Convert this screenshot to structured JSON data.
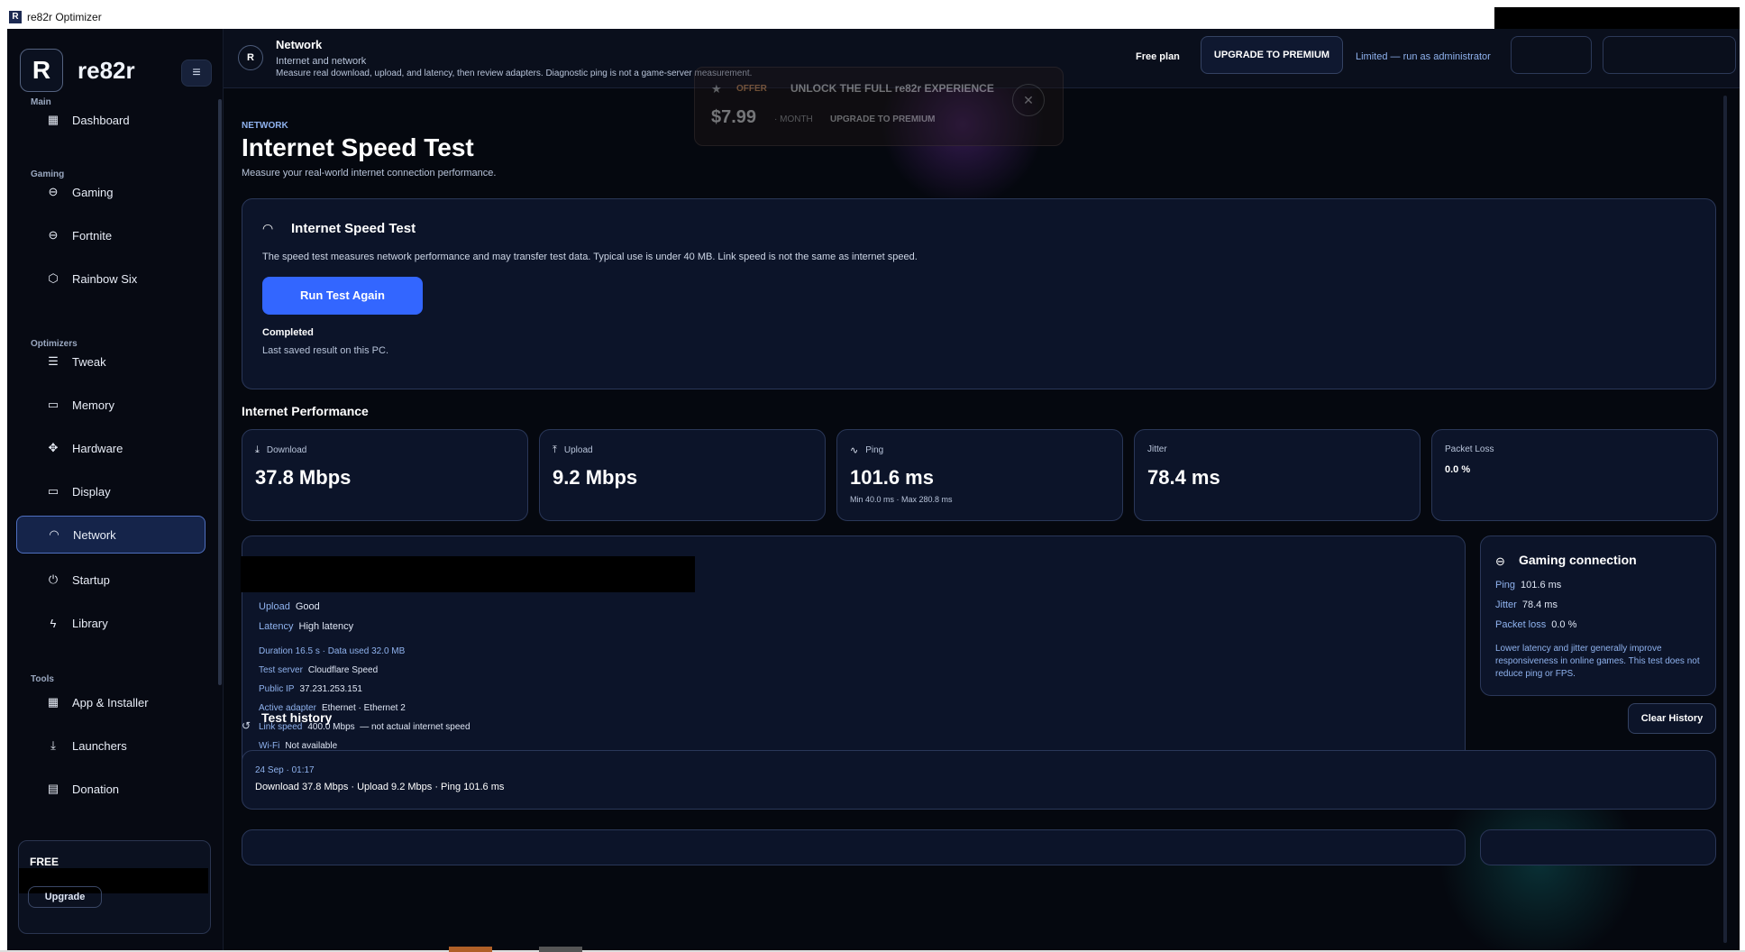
{
  "window": {
    "title": "re82r Optimizer",
    "app_icon": "R"
  },
  "sidebar": {
    "logo": "R",
    "brand": "re82r",
    "menu_icon": "≡",
    "sections": {
      "main": "Main",
      "gaming": "Gaming",
      "optimizers": "Optimizers",
      "tools": "Tools"
    },
    "items": [
      {
        "label": "Dashboard",
        "icon": "grid-icon"
      },
      {
        "label": "Gaming",
        "icon": "gamepad-icon"
      },
      {
        "label": "Fortnite",
        "icon": "gamepad-icon"
      },
      {
        "label": "Rainbow Six",
        "icon": "hexagon-icon"
      },
      {
        "label": "Tweak",
        "icon": "sliders-icon"
      },
      {
        "label": "Memory",
        "icon": "memory-icon"
      },
      {
        "label": "Hardware",
        "icon": "chip-icon"
      },
      {
        "label": "Display",
        "icon": "monitor-icon"
      },
      {
        "label": "Network",
        "icon": "wifi-icon"
      },
      {
        "label": "Startup",
        "icon": "power-icon"
      },
      {
        "label": "Library",
        "icon": "bolt-icon"
      },
      {
        "label": "App & Installer",
        "icon": "grid-icon"
      },
      {
        "label": "Launchers",
        "icon": "download-icon"
      },
      {
        "label": "Donation",
        "icon": "gift-icon"
      }
    ],
    "plan_card": {
      "plan": "FREE",
      "button": "Upgrade"
    }
  },
  "header": {
    "icon": "R",
    "title": "Network",
    "subtitle": "Internet and network",
    "description": "Measure real download, upload, and latency, then review adapters. Diagnostic ping is not a game-server measurement.",
    "plan": "Free plan",
    "upgrade": "UPGRADE TO PREMIUM",
    "limited": "Limited — run as administrator"
  },
  "offer": {
    "tag": "OFFER",
    "headline": "UNLOCK THE FULL re82r EXPERIENCE",
    "price": "$7.99",
    "period": "· MONTH",
    "cta": "UPGRADE TO PREMIUM"
  },
  "page": {
    "crumb": "NETWORK",
    "title": "Internet Speed Test",
    "subtitle": "Measure your real-world internet connection performance."
  },
  "speed_test": {
    "title": "Internet Speed Test",
    "note": "The speed test measures network performance and may transfer test data. Typical use is under 40 MB. Link speed is not the same as internet speed.",
    "button": "Run Test Again",
    "status": "Completed",
    "saved": "Last saved result on this PC."
  },
  "performance": {
    "title": "Internet Performance",
    "metrics": [
      {
        "label": "Download",
        "icon": "download-icon",
        "value": "37.8 Mbps",
        "sub": ""
      },
      {
        "label": "Upload",
        "icon": "upload-icon",
        "value": "9.2 Mbps",
        "sub": ""
      },
      {
        "label": "Ping",
        "icon": "pulse-icon",
        "value": "101.6 ms",
        "sub": "Min 40.0 ms · Max 280.8 ms"
      },
      {
        "label": "Jitter",
        "icon": "",
        "value": "78.4 ms",
        "sub": ""
      },
      {
        "label": "Packet Loss",
        "icon": "",
        "value": "0.0 %",
        "sub": ""
      }
    ]
  },
  "details": {
    "upload": {
      "k": "Upload",
      "v": "Good"
    },
    "latency": {
      "k": "Latency",
      "v": "High latency"
    },
    "duration": "Duration  16.5 s  · Data used  32.0 MB",
    "server": {
      "k": "Test server",
      "v": "Cloudflare Speed"
    },
    "ip": {
      "k": "Public IP",
      "v": "37.231.253.151"
    },
    "adapter": {
      "k": "Active adapter",
      "v": "Ethernet · Ethernet 2"
    },
    "link": {
      "k": "Link speed",
      "v": "400.0 Mbps",
      "note": "— not actual internet speed"
    },
    "wifi": {
      "k": "Wi-Fi",
      "v": "Not available"
    }
  },
  "gaming": {
    "title": "Gaming connection",
    "ping": {
      "k": "Ping",
      "v": "101.6 ms"
    },
    "jitter": {
      "k": "Jitter",
      "v": "78.4 ms"
    },
    "loss": {
      "k": "Packet loss",
      "v": "0.0 %"
    },
    "note": "Lower latency and jitter generally improve responsiveness in online games. This test does not reduce ping or FPS."
  },
  "history": {
    "title": "Test history",
    "clear": "Clear History",
    "items": [
      {
        "date": "24 Sep · 01:17",
        "summary": "Download 37.8 Mbps  ·  Upload 9.2 Mbps  ·  Ping 101.6 ms"
      }
    ]
  },
  "colors": {
    "accent": "#3366ff",
    "bg": "#05080f",
    "card": "#0c1429",
    "link": "#8fb2ee"
  }
}
